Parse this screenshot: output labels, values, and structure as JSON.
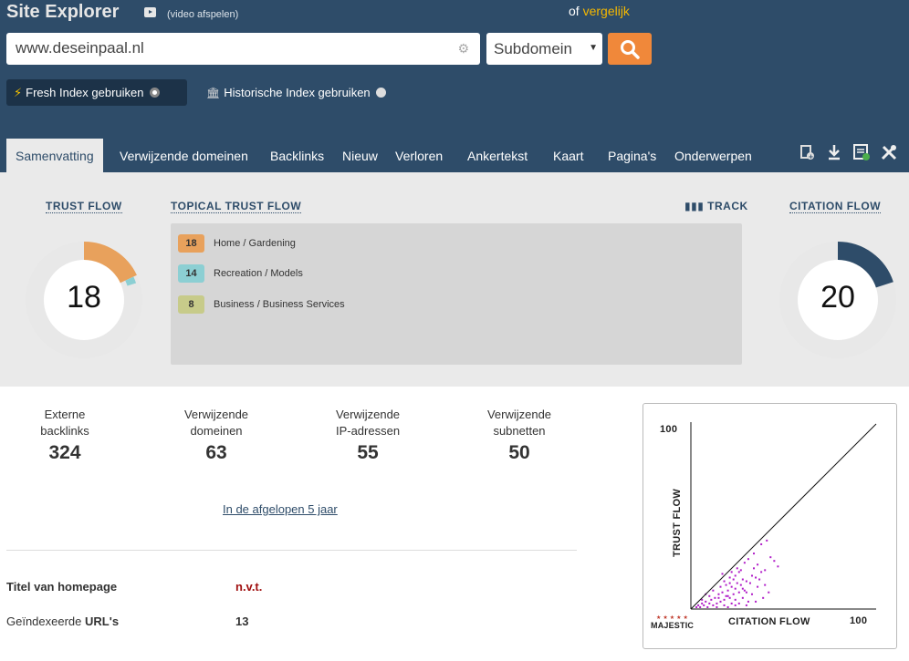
{
  "header": {
    "title": "Site Explorer",
    "video_link": "(video afspelen)",
    "compare_prefix": "of",
    "compare_link": "vergelijk",
    "search": {
      "value": "www.deseinpaal.nl",
      "placeholder": ""
    },
    "scope": "Subdomein",
    "index_fresh": "Fresh Index gebruiken",
    "index_historic": "Historische Index gebruiken"
  },
  "tabs": [
    {
      "label": "Samenvatting",
      "active": true
    },
    {
      "label": "Verwijzende domeinen"
    },
    {
      "label": "Backlinks"
    },
    {
      "label": "Nieuw"
    },
    {
      "label": "Verloren"
    },
    {
      "label": "Ankertekst"
    },
    {
      "label": "Kaart"
    },
    {
      "label": "Pagina's"
    },
    {
      "label": "Onderwerpen"
    }
  ],
  "tool_icons": [
    "bulk-backlinks-icon",
    "download-icon",
    "report-icon",
    "tools-icon"
  ],
  "metrics": {
    "trust_flow_label": "TRUST FLOW",
    "trust_flow": 18,
    "citation_flow_label": "CITATION FLOW",
    "citation_flow": 20,
    "topical_label": "TOPICAL TRUST FLOW",
    "track_label": "TRACK",
    "topics": [
      {
        "value": "18",
        "label": "Home / Gardening",
        "color": "#e8a15c"
      },
      {
        "value": "14",
        "label": "Recreation / Models",
        "color": "#8ccfd3"
      },
      {
        "value": "8",
        "label": "Business / Business Services",
        "color": "#c7cb8a"
      }
    ],
    "colors": {
      "trust": "#e8a15c",
      "trust_secondary": "#8ccfd3",
      "citation": "#2e4c69",
      "track": "#e8e8e8"
    }
  },
  "stats": [
    {
      "label_1": "Externe",
      "label_2": "backlinks",
      "value": "324"
    },
    {
      "label_1": "Verwijzende",
      "label_2": "domeinen",
      "value": "63"
    },
    {
      "label_1": "Verwijzende",
      "label_2": "IP-adressen",
      "value": "55"
    },
    {
      "label_1": "Verwijzende",
      "label_2": "subnetten",
      "value": "50"
    }
  ],
  "period_link": "In de afgelopen 5 jaar",
  "info": {
    "homepage_title_label": "Titel van homepage",
    "homepage_title_value": "n.v.t.",
    "indexed_label_prefix": "Geïndexeerde ",
    "indexed_label_bold": "URL's",
    "indexed_value": "13"
  },
  "chart_data": {
    "type": "scatter",
    "xlabel": "CITATION FLOW",
    "ylabel": "TRUST FLOW",
    "xlim": [
      0,
      100
    ],
    "ylim": [
      0,
      100
    ],
    "x_max_label": "100",
    "y_max_label": "100",
    "points": [
      [
        3,
        1
      ],
      [
        4,
        2
      ],
      [
        5,
        1
      ],
      [
        6,
        3
      ],
      [
        7,
        2
      ],
      [
        8,
        4
      ],
      [
        9,
        1
      ],
      [
        10,
        3
      ],
      [
        11,
        5
      ],
      [
        12,
        2
      ],
      [
        13,
        6
      ],
      [
        14,
        3
      ],
      [
        15,
        8
      ],
      [
        16,
        4
      ],
      [
        17,
        9
      ],
      [
        18,
        5
      ],
      [
        19,
        7
      ],
      [
        20,
        10
      ],
      [
        21,
        6
      ],
      [
        22,
        12
      ],
      [
        23,
        8
      ],
      [
        24,
        11
      ],
      [
        25,
        14
      ],
      [
        26,
        9
      ],
      [
        27,
        13
      ],
      [
        28,
        16
      ],
      [
        29,
        10
      ],
      [
        30,
        15
      ],
      [
        14,
        1
      ],
      [
        18,
        2
      ],
      [
        20,
        1
      ],
      [
        22,
        3
      ],
      [
        24,
        2
      ],
      [
        16,
        12
      ],
      [
        18,
        15
      ],
      [
        21,
        17
      ],
      [
        24,
        18
      ],
      [
        19,
        13
      ],
      [
        26,
        20
      ],
      [
        28,
        11
      ],
      [
        30,
        9
      ],
      [
        32,
        14
      ],
      [
        33,
        8
      ],
      [
        35,
        17
      ],
      [
        36,
        12
      ],
      [
        38,
        20
      ],
      [
        22,
        20
      ],
      [
        25,
        22
      ],
      [
        29,
        25
      ],
      [
        27,
        21
      ],
      [
        31,
        27
      ],
      [
        34,
        22
      ],
      [
        20,
        7
      ],
      [
        15,
        6
      ],
      [
        12,
        10
      ],
      [
        10,
        7
      ],
      [
        8,
        8
      ],
      [
        6,
        5
      ],
      [
        23,
        16
      ],
      [
        21,
        14
      ],
      [
        34,
        30
      ],
      [
        38,
        35
      ],
      [
        41,
        37
      ],
      [
        43,
        28
      ],
      [
        45,
        26
      ],
      [
        40,
        21
      ],
      [
        36,
        24
      ],
      [
        47,
        23
      ],
      [
        33,
        18
      ],
      [
        37,
        16
      ],
      [
        40,
        13
      ],
      [
        42,
        9
      ],
      [
        39,
        6
      ],
      [
        31,
        4
      ],
      [
        28,
        6
      ],
      [
        26,
        3
      ],
      [
        24,
        5
      ],
      [
        30,
        2
      ],
      [
        35,
        4
      ],
      [
        17,
        19
      ]
    ],
    "caption": "MAJESTIC"
  }
}
